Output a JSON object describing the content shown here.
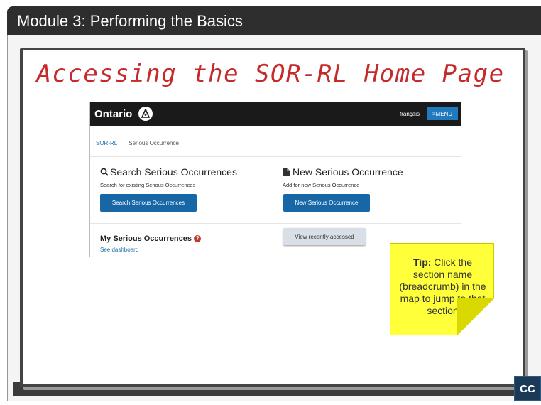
{
  "module": {
    "title": "Module 3:  Performing the Basics"
  },
  "slide": {
    "heading": "Accessing the SOR-RL Home Page"
  },
  "screenshot": {
    "header": {
      "logo_text": "Ontario",
      "lang_link": "français",
      "menu_label": "≡MENU"
    },
    "breadcrumb": {
      "home": "SOR-RL",
      "separator": "→",
      "current": "Serious Occurrence"
    },
    "search_section": {
      "icon": "search-icon",
      "title": "Search Serious Occurrences",
      "description": "Search for existing Serious Occurrences",
      "button_label": "Search Serious Occurrences"
    },
    "new_section": {
      "icon": "document-icon",
      "title": "New Serious Occurrence",
      "description": "Add for new Serious Occurrence",
      "button_label": "New Serious Occurrence"
    },
    "my_section": {
      "title": "My Serious Occurrences",
      "help_icon": "?",
      "link": "See dashboard"
    },
    "recent_button": "View recently accessed"
  },
  "tip": {
    "label": "Tip:",
    "text": "Click the section name (breadcrumb)  in the map to jump to that section"
  },
  "controls": {
    "cc_label": "CC"
  },
  "colors": {
    "accent_blue": "#1766a6",
    "tip_yellow": "#ffff3a",
    "heading_red": "#c72a2a"
  }
}
